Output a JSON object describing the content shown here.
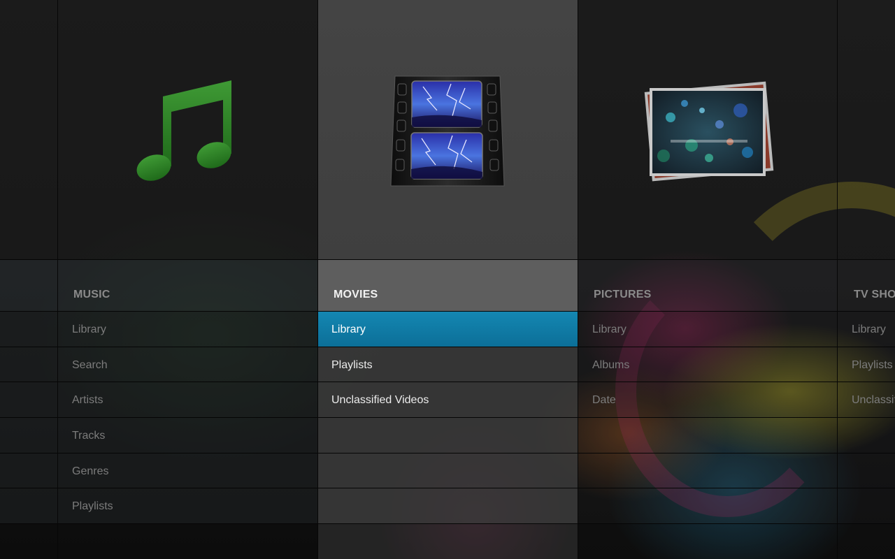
{
  "columns": [
    {
      "title": "MUSIC",
      "icon": "music-note-icon",
      "items": [
        "Library",
        "Search",
        "Artists",
        "Tracks",
        "Genres",
        "Playlists"
      ]
    },
    {
      "title": "MOVIES",
      "icon": "film-strip-icon",
      "items": [
        "Library",
        "Playlists",
        "Unclassified Videos",
        "",
        "",
        ""
      ],
      "selected_item": "Library"
    },
    {
      "title": "PICTURES",
      "icon": "photos-icon",
      "items": [
        "Library",
        "Albums",
        "Date",
        "",
        "",
        ""
      ]
    },
    {
      "title": "TV SHOWS",
      "icon": "tv-icon",
      "items": [
        "Library",
        "Playlists",
        "Unclassified",
        "",
        "",
        ""
      ]
    }
  ],
  "colors": {
    "accent": "#1183b0",
    "active_column": "#444444",
    "background": "#1a1a1a"
  }
}
